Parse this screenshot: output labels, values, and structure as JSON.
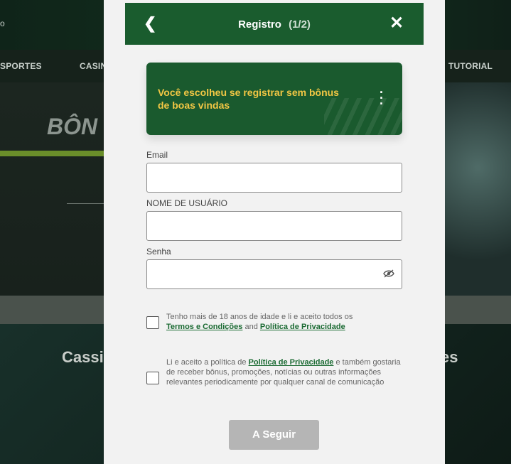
{
  "background": {
    "top_text": "o",
    "nav": [
      "SPORTES",
      "CASIN",
      "TUTORIAL"
    ],
    "hero_text": "BÔN",
    "bottom_left": "Cassi",
    "bottom_right": "es"
  },
  "modal": {
    "title": "Registro",
    "step": "(1/2)",
    "banner_text": "Você escolheu se registrar sem bônus de boas vindas",
    "fields": {
      "email_label": "Email",
      "email_value": "",
      "username_label": "NOME DE USUÁRIO",
      "username_value": "",
      "password_label": "Senha",
      "password_value": ""
    },
    "terms1": {
      "prefix": "Tenho mais de 18 anos de idade e li e aceito todos os",
      "link1": "Termos e Condições",
      "and": "and",
      "link2": "Política de Privacidade"
    },
    "terms2": {
      "prefix": "Li e aceito a política de",
      "link": "Política de Privacidade",
      "suffix": "e também gostaria de receber bônus, promoções, notícias ou outras informações relevantes periodicamente por qualquer canal de comunicação"
    },
    "submit_label": "A Seguir"
  },
  "colors": {
    "header_green": "#1a5c2e",
    "banner_green": "#1a5a2e",
    "banner_text": "#f2c744",
    "submit_disabled": "#b5b5b5",
    "link_green": "#1a6a32"
  },
  "icons": {
    "back": "chevron-left-icon",
    "close": "close-icon",
    "menu": "kebab-menu-icon",
    "password_toggle": "eye-off-icon"
  }
}
